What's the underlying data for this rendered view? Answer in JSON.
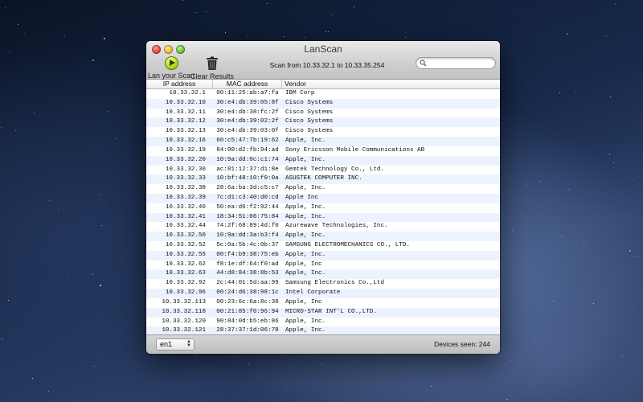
{
  "window": {
    "title": "LanScan"
  },
  "toolbar": {
    "scan_label": "Lan your Scan",
    "clear_label": "Clear Results",
    "scan_range": "Scan from 10.33.32.1 to 10.33.35.254",
    "search_placeholder": ""
  },
  "table": {
    "headers": {
      "ip": "IP address",
      "mac": "MAC address",
      "vendor": "Vendor"
    },
    "rows": [
      {
        "ip": "10.33.32.1",
        "mac": "00:11:25:ab:a7:fa",
        "vendor": "IBM Corp"
      },
      {
        "ip": "10.33.32.10",
        "mac": "30:e4:db:39:05:8f",
        "vendor": "Cisco Systems"
      },
      {
        "ip": "10.33.32.11",
        "mac": "30:e4:db:38:fc:2f",
        "vendor": "Cisco Systems"
      },
      {
        "ip": "10.33.32.12",
        "mac": "30:e4:db:39:02:2f",
        "vendor": "Cisco Systems"
      },
      {
        "ip": "10.33.32.13",
        "mac": "30:e4:db:39:03:0f",
        "vendor": "Cisco Systems"
      },
      {
        "ip": "10.33.32.16",
        "mac": "60:c5:47:7b:19:62",
        "vendor": "Apple, Inc."
      },
      {
        "ip": "10.33.32.19",
        "mac": "84:00:d2:fb:94:ad",
        "vendor": "Sony Ericsson Mobile Communications AB"
      },
      {
        "ip": "10.33.32.20",
        "mac": "10:9a:dd:0c:c1:74",
        "vendor": "Apple, Inc."
      },
      {
        "ip": "10.33.32.30",
        "mac": "ac:81:12:37:d1:8e",
        "vendor": "Gemtek Technology Co., Ltd."
      },
      {
        "ip": "10.33.32.33",
        "mac": "10:bf:48:10:f0:0a",
        "vendor": "ASUSTEK COMPUTER INC."
      },
      {
        "ip": "10.33.32.38",
        "mac": "28:6a:ba:3d:c5:c7",
        "vendor": "Apple, Inc."
      },
      {
        "ip": "10.33.32.39",
        "mac": "7c:d1:c3:40:d0:cd",
        "vendor": "Apple Inc"
      },
      {
        "ip": "10.33.32.40",
        "mac": "50:ea:d6:f2:92:44",
        "vendor": "Apple, Inc."
      },
      {
        "ip": "10.33.32.41",
        "mac": "18:34:51:06:75:84",
        "vendor": "Apple, Inc."
      },
      {
        "ip": "10.33.32.44",
        "mac": "74:2f:68:89:4d:f0",
        "vendor": "Azurewave Technologies, Inc."
      },
      {
        "ip": "10.33.32.50",
        "mac": "10:9a:dd:3a:b3:f4",
        "vendor": "Apple, Inc."
      },
      {
        "ip": "10.33.32.52",
        "mac": "5c:0a:5b:4c:0b:37",
        "vendor": "SAMSUNG ELECTROMECHANICS CO., LTD."
      },
      {
        "ip": "10.33.32.55",
        "mac": "00:f4:b9:38:75:eb",
        "vendor": "Apple, Inc."
      },
      {
        "ip": "10.33.32.62",
        "mac": "f8:1e:df:64:f0:ad",
        "vendor": "Apple, Inc"
      },
      {
        "ip": "10.33.32.63",
        "mac": "44:d8:84:38:8b:53",
        "vendor": "Apple, Inc."
      },
      {
        "ip": "10.33.32.92",
        "mac": "2c:44:01:5d:aa:99",
        "vendor": "Samsung Electronics Co.,Ltd"
      },
      {
        "ip": "10.33.32.96",
        "mac": "00:24:d6:38:98:1c",
        "vendor": "Intel Corporate"
      },
      {
        "ip": "10.33.32.113",
        "mac": "00:23:6c:6a:8c:38",
        "vendor": "Apple, Inc"
      },
      {
        "ip": "10.33.32.118",
        "mac": "00:21:85:f0:96:94",
        "vendor": "MICRO-STAR INT'L CO.,LTD."
      },
      {
        "ip": "10.33.32.120",
        "mac": "90:84:0d:b5:eb:86",
        "vendor": "Apple, Inc."
      },
      {
        "ip": "10.33.32.121",
        "mac": "28:37:37:1d:06:78",
        "vendor": "Apple, Inc."
      }
    ]
  },
  "status": {
    "interface": "en1",
    "devices_seen": "Devices seen: 244"
  },
  "icons": {
    "scan": "play-icon",
    "clear": "trash-icon",
    "search": "magnifier-icon"
  },
  "colors": {
    "row_alt": "#edf3fe",
    "scan_button": "#b8e01e"
  }
}
